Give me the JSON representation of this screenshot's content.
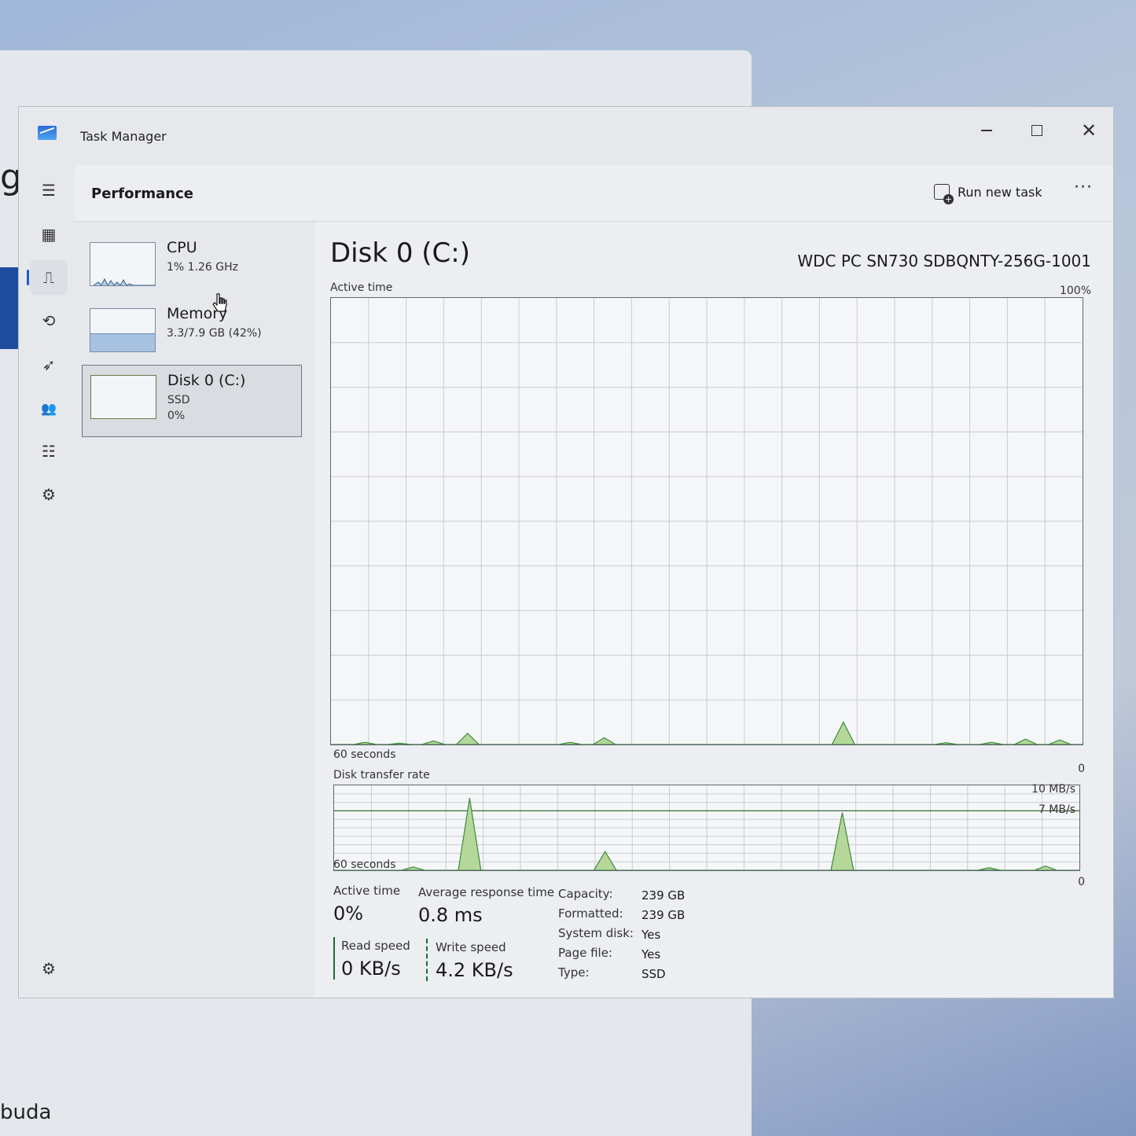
{
  "background": {
    "fragment_text": "gh",
    "bottom_text": "buda"
  },
  "window": {
    "title": "Task Manager",
    "controls": [
      "minimize",
      "maximize",
      "close"
    ]
  },
  "nav_rail": {
    "items": [
      {
        "name": "menu-icon",
        "glyph": "☰"
      },
      {
        "name": "processes-icon",
        "glyph": "▦"
      },
      {
        "name": "performance-icon",
        "glyph": "⎍",
        "active": true
      },
      {
        "name": "app-history-icon",
        "glyph": "⟲"
      },
      {
        "name": "startup-apps-icon",
        "glyph": "➶"
      },
      {
        "name": "users-icon",
        "glyph": "👥"
      },
      {
        "name": "details-icon",
        "glyph": "☷"
      },
      {
        "name": "services-icon",
        "glyph": "⚙"
      }
    ],
    "settings_glyph": "⚙"
  },
  "header": {
    "title": "Performance",
    "run_new_task": "Run new task",
    "more": "···"
  },
  "devices": [
    {
      "name": "CPU",
      "sub1": "1%  1.26 GHz",
      "sub2": ""
    },
    {
      "name": "Memory",
      "sub1": "3.3/7.9 GB (42%)",
      "sub2": ""
    },
    {
      "name": "Disk 0 (C:)",
      "sub1": "SSD",
      "sub2": "0%",
      "selected": true
    }
  ],
  "disk": {
    "title": "Disk 0 (C:)",
    "model": "WDC PC SN730 SDBQNTY-256G-1001",
    "active_time_graph": {
      "label": "Active time",
      "max_label": "100%",
      "x_label": "60 seconds",
      "min_label": "0",
      "points": [
        0,
        0,
        0,
        0.5,
        0,
        0,
        0.3,
        0,
        0,
        0.8,
        0,
        0,
        2.5,
        0,
        0,
        0,
        0,
        0,
        0,
        0,
        0,
        0.5,
        0,
        0,
        1.5,
        0,
        0,
        0,
        0,
        0,
        0,
        0,
        0,
        0,
        0,
        0,
        0,
        0,
        0,
        0,
        0,
        0,
        0,
        0,
        0,
        5.0,
        0,
        0,
        0,
        0,
        0,
        0,
        0,
        0,
        0.4,
        0,
        0,
        0,
        0.5,
        0,
        0,
        1.2,
        0,
        0,
        1.0,
        0,
        0
      ]
    },
    "transfer_graph": {
      "label": "Disk transfer rate",
      "max_label": "10 MB/s",
      "ref_label": "7 MB/s",
      "x_label": "60 seconds",
      "min_label": "0",
      "points": [
        0,
        0,
        0,
        0,
        0,
        0,
        0,
        0.4,
        0,
        0,
        0,
        0,
        8.5,
        0,
        0,
        0,
        0,
        0,
        0,
        0,
        0,
        0,
        0,
        0,
        2.2,
        0,
        0,
        0,
        0,
        0,
        0,
        0,
        0,
        0,
        0,
        0,
        0,
        0,
        0,
        0,
        0,
        0,
        0,
        0,
        0,
        6.8,
        0,
        0,
        0,
        0,
        0,
        0,
        0,
        0,
        0,
        0,
        0,
        0,
        0.3,
        0,
        0,
        0,
        0,
        0.5,
        0,
        0,
        0
      ]
    },
    "stats": {
      "active_time_label": "Active time",
      "active_time_value": "0%",
      "avg_response_label": "Average response time",
      "avg_response_value": "0.8 ms",
      "read_speed_label": "Read speed",
      "read_speed_value": "0 KB/s",
      "write_speed_label": "Write speed",
      "write_speed_value": "4.2 KB/s"
    },
    "properties": [
      {
        "label": "Capacity:",
        "value": "239 GB"
      },
      {
        "label": "Formatted:",
        "value": "239 GB"
      },
      {
        "label": "System disk:",
        "value": "Yes"
      },
      {
        "label": "Page file:",
        "value": "Yes"
      },
      {
        "label": "Type:",
        "value": "SSD"
      }
    ]
  },
  "colors": {
    "graph_line": "#3c8a3c",
    "graph_fill": "#b5d79a",
    "accent": "#1a5fc9"
  }
}
